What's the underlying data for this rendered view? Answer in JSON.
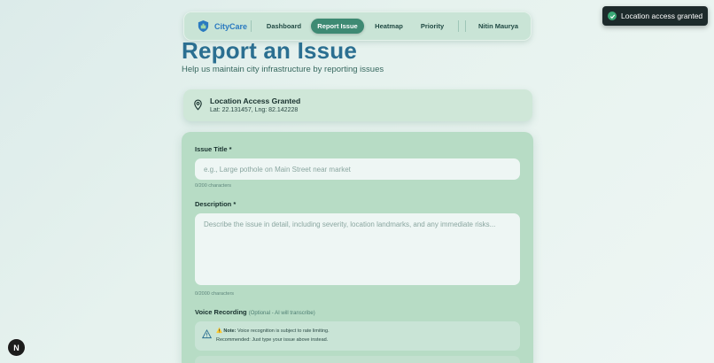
{
  "nav": {
    "brand": "CityCare",
    "items": [
      {
        "label": "Dashboard"
      },
      {
        "label": "Report Issue",
        "active": true
      },
      {
        "label": "Heatmap"
      },
      {
        "label": "Priority"
      }
    ],
    "user": "Nitin Maurya"
  },
  "page": {
    "title": "Report an Issue",
    "subtitle": "Help us maintain city infrastructure by reporting issues"
  },
  "location": {
    "title": "Location Access Granted",
    "coords": "Lat: 22.131457, Lng: 82.142228",
    "icon": "map-pin-icon"
  },
  "form": {
    "title_label": "Issue Title *",
    "title_placeholder": "e.g., Large pothole on Main Street near market",
    "title_count": "0/200 characters",
    "desc_label": "Description *",
    "desc_placeholder": "Describe the issue in detail, including severity, location landmarks, and any immediate risks...",
    "desc_count": "0/2000 characters",
    "voice_label": "Voice Recording",
    "voice_optional": "(Optional - AI will transcribe)",
    "note_prefix": "⚠️ Note:",
    "note_text": " Voice recognition is subject to rate limiting.",
    "note_line2": "Recommended: Just type your issue above instead."
  },
  "toast": {
    "text": "Location access granted"
  },
  "fab": {
    "label": "N"
  },
  "colors": {
    "accent": "#3e8a73",
    "brand": "#2a7ac0",
    "title": "#2b6f91"
  }
}
